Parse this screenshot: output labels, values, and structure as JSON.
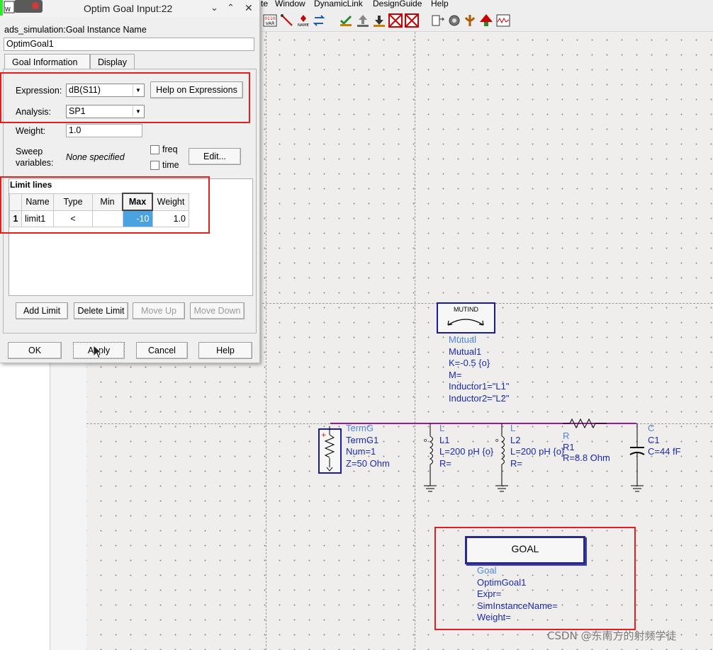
{
  "menu": {
    "items": [
      "te",
      "Window",
      "DynamicLink",
      "DesignGuide",
      "Help"
    ]
  },
  "toolbar": {
    "icons": [
      "var-icon",
      "wire-icon",
      "name-icon",
      "pin-icon",
      "swap-icon",
      "check-icon",
      "push-up-icon",
      "push-down-icon",
      "deactivate-icon",
      "shortout-icon",
      "probe-icon",
      "tune-icon",
      "optimize-icon",
      "simulate-icon",
      "results-icon"
    ]
  },
  "dialog": {
    "title": "Optim Goal Input:22",
    "instance_label": "ads_simulation:Goal Instance Name",
    "instance_value": "OptimGoal1",
    "tabs": [
      {
        "label": "Goal Information"
      },
      {
        "label": "Display"
      }
    ],
    "expression_label": "Expression:",
    "expression_value": "dB(S11)",
    "help_expr_button": "Help on Expressions",
    "analysis_label": "Analysis:",
    "analysis_value": "SP1",
    "weight_label": "Weight:",
    "weight_value": "1.0",
    "sweep_label_1": "Sweep",
    "sweep_label_2": "variables:",
    "sweep_value": "None specified",
    "freq_label": "freq",
    "time_label": "time",
    "edit_button": "Edit...",
    "limit_title": "Limit lines",
    "limit_columns": [
      "Name",
      "Type",
      "Min",
      "Max",
      "Weight"
    ],
    "limit_rows": [
      {
        "num": "1",
        "name": "limit1",
        "type": "<",
        "min": "",
        "max": "-10",
        "weight": "1.0"
      }
    ],
    "add_limit": "Add Limit",
    "delete_limit": "Delete Limit",
    "move_up": "Move Up",
    "move_down": "Move Down",
    "ok": "OK",
    "apply": "Apply",
    "cancel": "Cancel",
    "help": "Help"
  },
  "schematic": {
    "mutind": {
      "symbol_label": "MUTIND",
      "lines": [
        "Mutual",
        "Mutual1",
        "K=-0.5 {o}",
        "M=",
        "Inductor1=\"L1\"",
        "Inductor2=\"L2\""
      ]
    },
    "termg": {
      "lines": [
        "TermG",
        "TermG1",
        "Num=1",
        "Z=50 Ohm"
      ]
    },
    "l1": {
      "lines": [
        "L",
        "L1",
        "L=200 pH {o}",
        "R="
      ]
    },
    "l2": {
      "lines": [
        "L",
        "L2",
        "L=200 pH {o}",
        "R="
      ]
    },
    "r1": {
      "lines": [
        "R",
        "R1",
        "R=8.8 Ohm"
      ]
    },
    "c1": {
      "lines": [
        "C",
        "C1",
        "C=44 fF"
      ]
    },
    "goal": {
      "symbol_label": "GOAL",
      "lines": [
        "Goal",
        "OptimGoal1",
        "Expr=",
        "SimInstanceName=",
        "Weight="
      ]
    }
  },
  "watermark": "CSDN @东南方的射频学徒",
  "colors": {
    "component_text": "#1a2bb0",
    "component_type": "#4f86d6",
    "wire": "#9a1a9a",
    "highlight_box": "#e21f1f",
    "selection": "#4aa3e0"
  }
}
